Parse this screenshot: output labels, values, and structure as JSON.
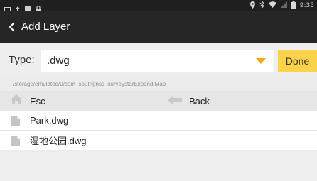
{
  "status_bar": {
    "time": "9:35",
    "icons": [
      "screen-icon",
      "upload-icon",
      "gallery-icon",
      "lock-icon",
      "location-icon",
      "bluetooth-icon",
      "wifi-icon",
      "signal-icon",
      "battery-icon"
    ]
  },
  "app_bar": {
    "title": "Add Layer"
  },
  "type_selector": {
    "label": "Type:",
    "value": ".dwg",
    "done_label": "Done"
  },
  "path": "/storage/emulated/0/com_southgnss_surveystarExpand/Map",
  "nav": {
    "esc_label": "Esc",
    "back_label": "Back"
  },
  "files": [
    {
      "name": "Park.dwg"
    },
    {
      "name": "湿地公园.dwg"
    }
  ],
  "colors": {
    "appbar": "#262626",
    "accent": "#fbd24a",
    "dropdown": "#f2a900"
  }
}
